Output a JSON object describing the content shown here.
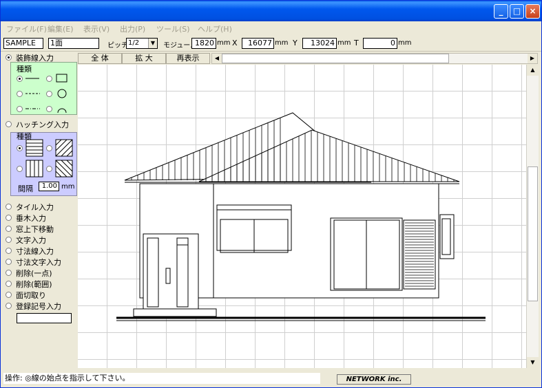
{
  "window": {
    "controls": {
      "minimize": "_",
      "maximize": "□",
      "close": "×"
    }
  },
  "menu": [
    "ファイル(F)",
    "編集(E)",
    "表示(V)",
    "出力(P)",
    "ツール(S)",
    "ヘルプ(H)"
  ],
  "toolbar": {
    "name": "SAMPLE",
    "face": "1面",
    "pitch_label": "ピッチ",
    "pitch_value": "1/2",
    "module_label": "モジュール",
    "module_value": "1820",
    "module_unit": "mm",
    "x_label": "X",
    "x_value": "16077",
    "x_unit": "mm",
    "y_label": "Y",
    "y_value": "13024",
    "y_unit": "mm",
    "t_label": "T",
    "t_value": "0",
    "t_unit": "mm"
  },
  "tabs": [
    "全 体",
    "拡 大",
    "再表示"
  ],
  "sidebar": {
    "decor_label": "装飾線入力",
    "decor_kind": "種類",
    "hatch_label": "ハッチング入力",
    "hatch_kind": "種類",
    "spacing_label": "間隔",
    "spacing_value": "1.00",
    "spacing_unit": "mm",
    "items": [
      "タイル入力",
      "垂木入力",
      "窓上下移動",
      "文字入力",
      "寸法線入力",
      "寸法文字入力",
      "削除(一点)",
      "削除(範囲)",
      "面切取り",
      "登録記号入力"
    ]
  },
  "status": {
    "text": "操作: ◎線の始点を指示して下さい。",
    "brand": "NETWORK inc."
  }
}
